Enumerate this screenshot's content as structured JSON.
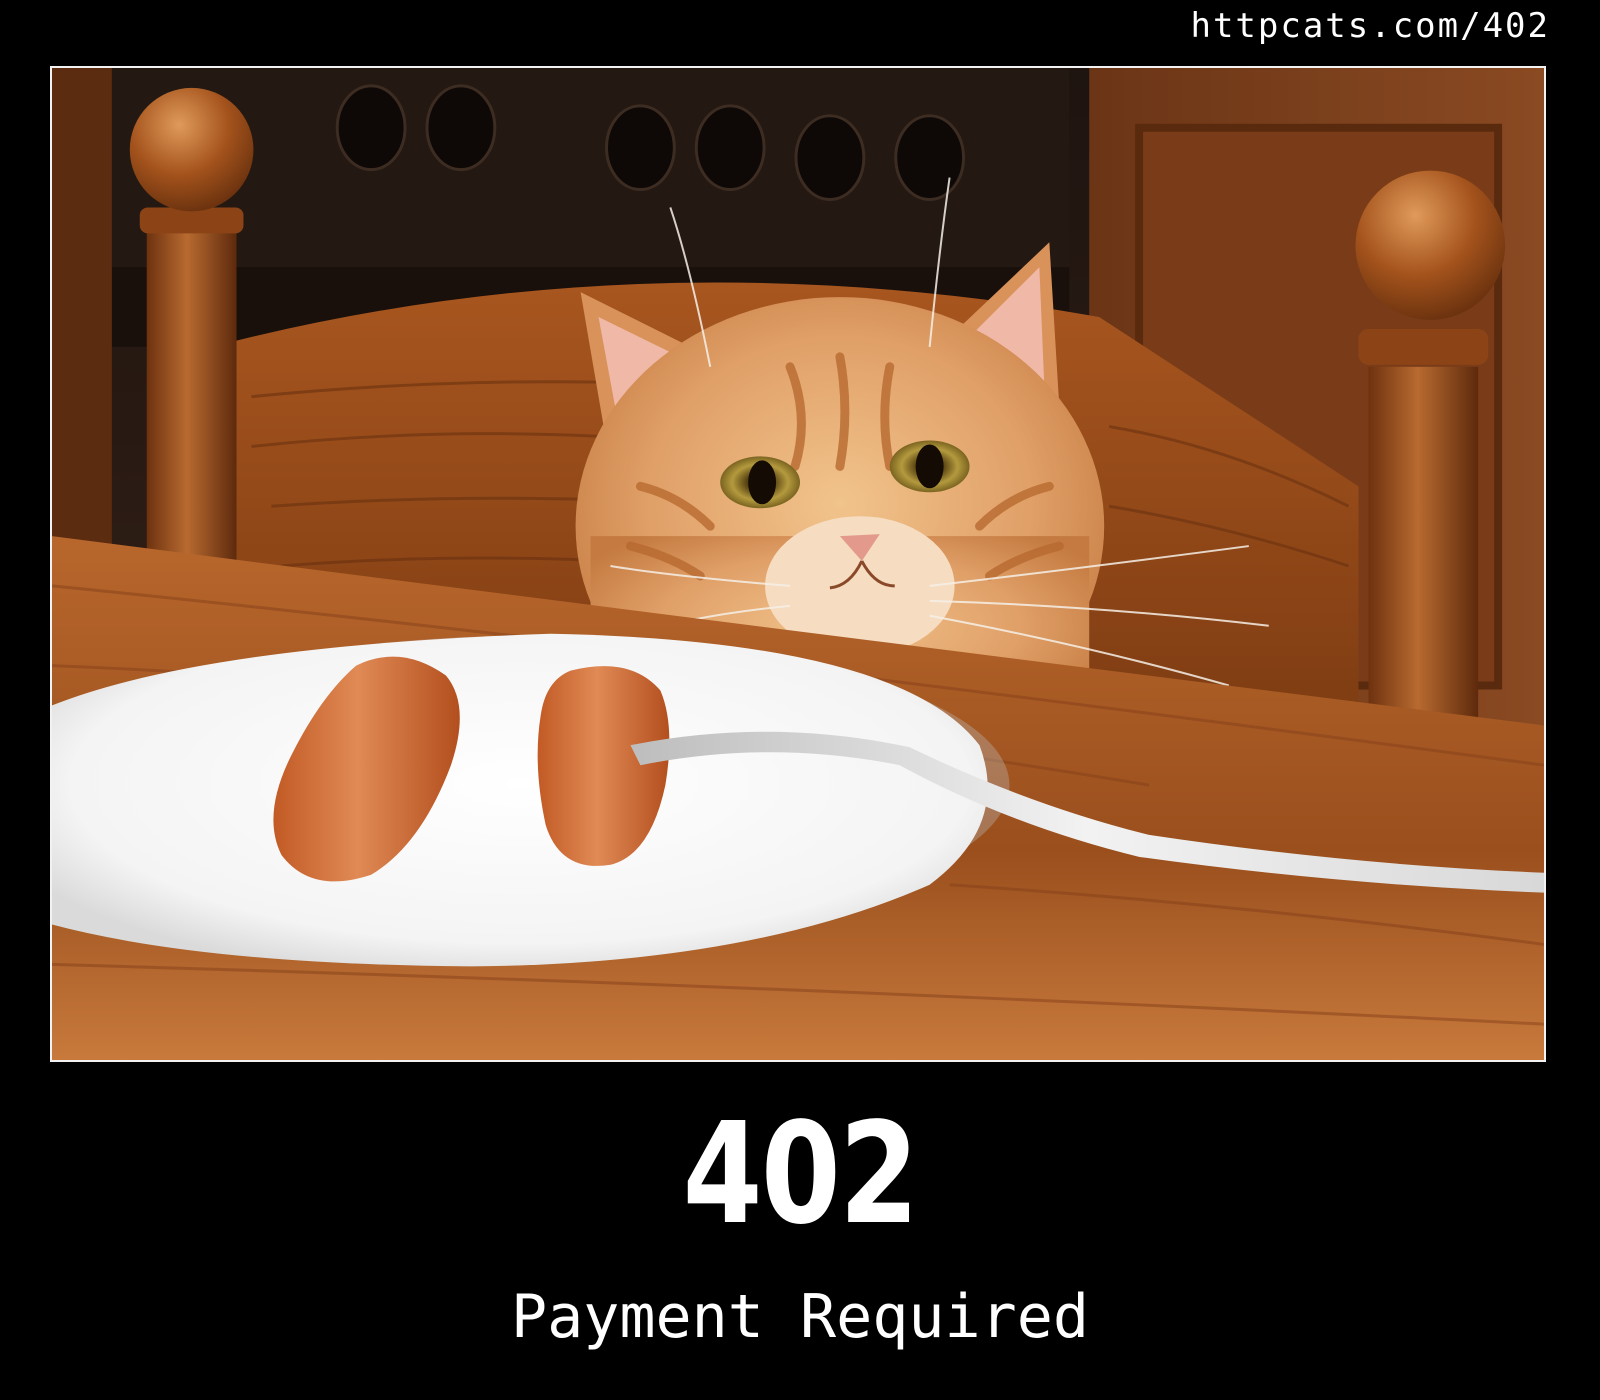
{
  "header": {
    "url": "httpcats.com/402"
  },
  "photo": {
    "subject_icon": "cat-icon"
  },
  "status": {
    "code": "402",
    "message": "Payment Required"
  },
  "colors": {
    "background": "#000000",
    "text": "#ffffff",
    "frame": "#f2f2f2"
  }
}
